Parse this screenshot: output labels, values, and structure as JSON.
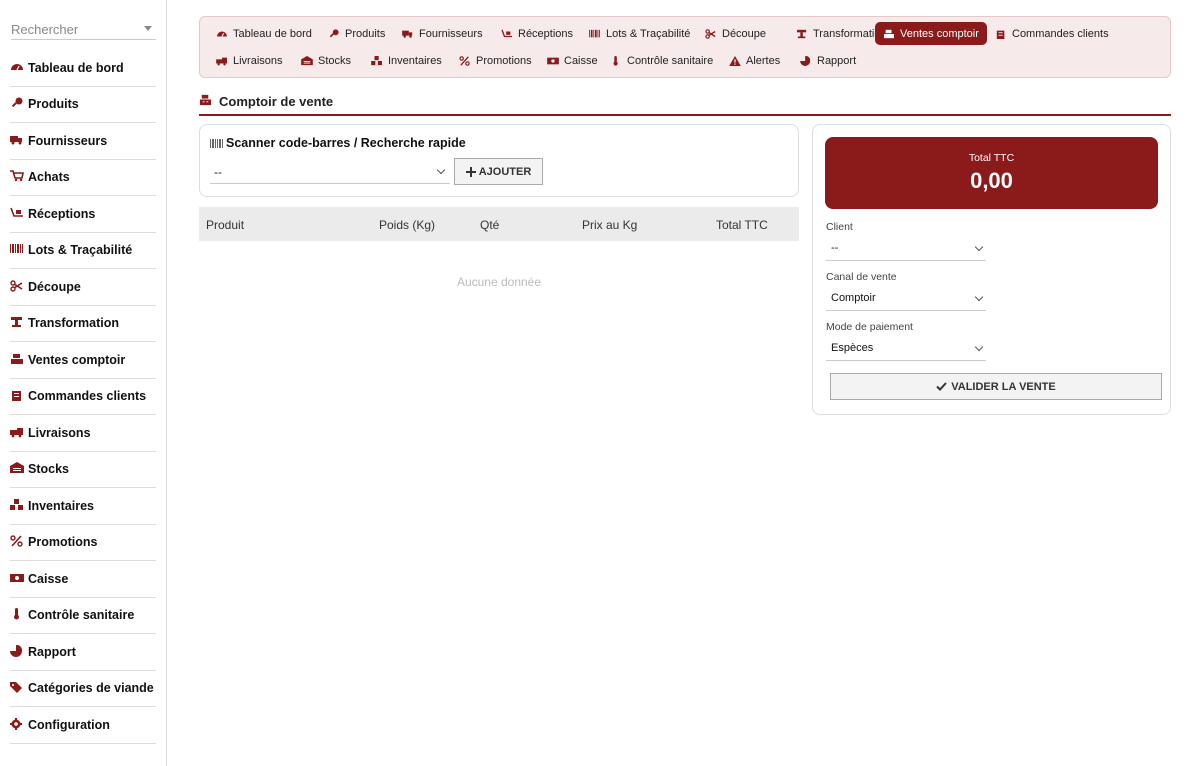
{
  "sidebar": {
    "search_placeholder": "Rechercher",
    "items": [
      {
        "label": "Tableau de bord",
        "icon": "dashboard-icon"
      },
      {
        "label": "Produits",
        "icon": "drumstick-icon"
      },
      {
        "label": "Fournisseurs",
        "icon": "truck-icon"
      },
      {
        "label": "Achats",
        "icon": "cart-icon"
      },
      {
        "label": "Réceptions",
        "icon": "dolly-icon"
      },
      {
        "label": "Lots & Traçabilité",
        "icon": "barcode-icon"
      },
      {
        "label": "Découpe",
        "icon": "scissors-icon"
      },
      {
        "label": "Transformation",
        "icon": "industry-icon"
      },
      {
        "label": "Ventes comptoir",
        "icon": "cash-register-icon"
      },
      {
        "label": "Commandes clients",
        "icon": "clipboard-icon"
      },
      {
        "label": "Livraisons",
        "icon": "shipping-icon"
      },
      {
        "label": "Stocks",
        "icon": "warehouse-icon"
      },
      {
        "label": "Inventaires",
        "icon": "boxes-icon"
      },
      {
        "label": "Promotions",
        "icon": "percent-icon"
      },
      {
        "label": "Caisse",
        "icon": "money-icon"
      },
      {
        "label": "Contrôle sanitaire",
        "icon": "thermometer-icon"
      },
      {
        "label": "Rapport",
        "icon": "pie-chart-icon"
      },
      {
        "label": "Catégories de viande",
        "icon": "tags-icon"
      },
      {
        "label": "Configuration",
        "icon": "gear-icon"
      }
    ]
  },
  "topnav": {
    "active": "Ventes comptoir",
    "row1": [
      {
        "label": "Tableau de bord",
        "icon": "dashboard-icon"
      },
      {
        "label": "Produits",
        "icon": "drumstick-icon"
      },
      {
        "label": "Fournisseurs",
        "icon": "truck-icon"
      },
      {
        "label": "Réceptions",
        "icon": "dolly-icon"
      },
      {
        "label": "Lots & Traçabilité",
        "icon": "barcode-icon"
      },
      {
        "label": "Découpe",
        "icon": "scissors-icon"
      },
      {
        "label": "Transformation",
        "icon": "industry-icon"
      },
      {
        "label": "Ventes comptoir",
        "icon": "cash-register-icon"
      },
      {
        "label": "Commandes clients",
        "icon": "clipboard-icon"
      }
    ],
    "row2": [
      {
        "label": "Livraisons",
        "icon": "shipping-icon"
      },
      {
        "label": "Stocks",
        "icon": "warehouse-icon"
      },
      {
        "label": "Inventaires",
        "icon": "boxes-icon"
      },
      {
        "label": "Promotions",
        "icon": "percent-icon"
      },
      {
        "label": "Caisse",
        "icon": "money-icon"
      },
      {
        "label": "Contrôle sanitaire",
        "icon": "thermometer-icon"
      },
      {
        "label": "Alertes",
        "icon": "warning-icon"
      },
      {
        "label": "Rapport",
        "icon": "pie-chart-icon"
      }
    ]
  },
  "page": {
    "title": "Comptoir de vente"
  },
  "scan": {
    "title": "Scanner code-barres / Recherche rapide",
    "select_value": "--",
    "add_label": "AJOUTER"
  },
  "table": {
    "columns": [
      "Produit",
      "Poids (Kg)",
      "Qté",
      "Prix au Kg",
      "Total TTC"
    ],
    "empty_text": "Aucune donnée"
  },
  "summary": {
    "total_label": "Total TTC",
    "total_value": "0,00",
    "client_label": "Client",
    "client_value": "--",
    "channel_label": "Canal de vente",
    "channel_value": "Comptoir",
    "payment_label": "Mode de paiement",
    "payment_value": "Espèces",
    "validate_label": "VALIDER LA VENTE"
  },
  "colors": {
    "accent": "#8b1a1a",
    "nav_bg": "#f6eaea"
  }
}
